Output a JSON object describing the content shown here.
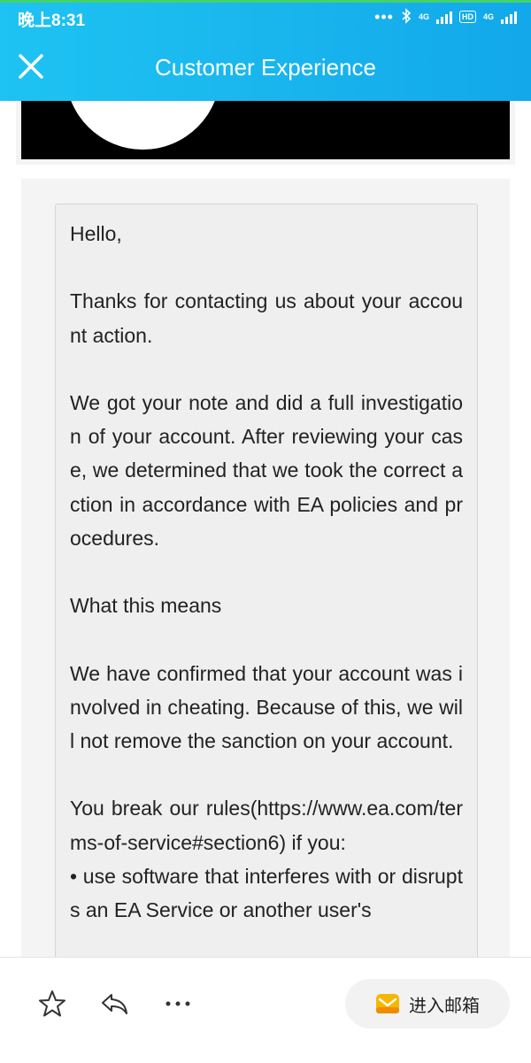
{
  "status_bar": {
    "time": "晚上8:31",
    "network_1": "4G",
    "network_2": "4G",
    "hd": "HD"
  },
  "header": {
    "title": "Customer Experience",
    "close_icon": "close-icon",
    "background_color": "#19b6ee"
  },
  "message": {
    "greeting": "Hello,",
    "paragraphs": [
      "Thanks for contacting us about your account action.",
      "We got your note and did a full investigation of your account. After reviewing your case, we determined that we took the correct action in accordance with EA policies and procedures.",
      "What this means",
      "We have confirmed that your account was involved in cheating. Because of this, we will not remove the sanction on your account.",
      "You break our rules(https://www.ea.com/terms-of-service#section6) if you:",
      "• use software that interferes with or disrupts an EA Service or another user's"
    ]
  },
  "bottom_bar": {
    "favorite_icon": "star-icon",
    "reply_icon": "reply-icon",
    "more_icon": "more-icon",
    "enter_mailbox_label": "进入邮箱",
    "mail_icon": "mail-icon",
    "mail_icon_color": "#f5b800"
  }
}
